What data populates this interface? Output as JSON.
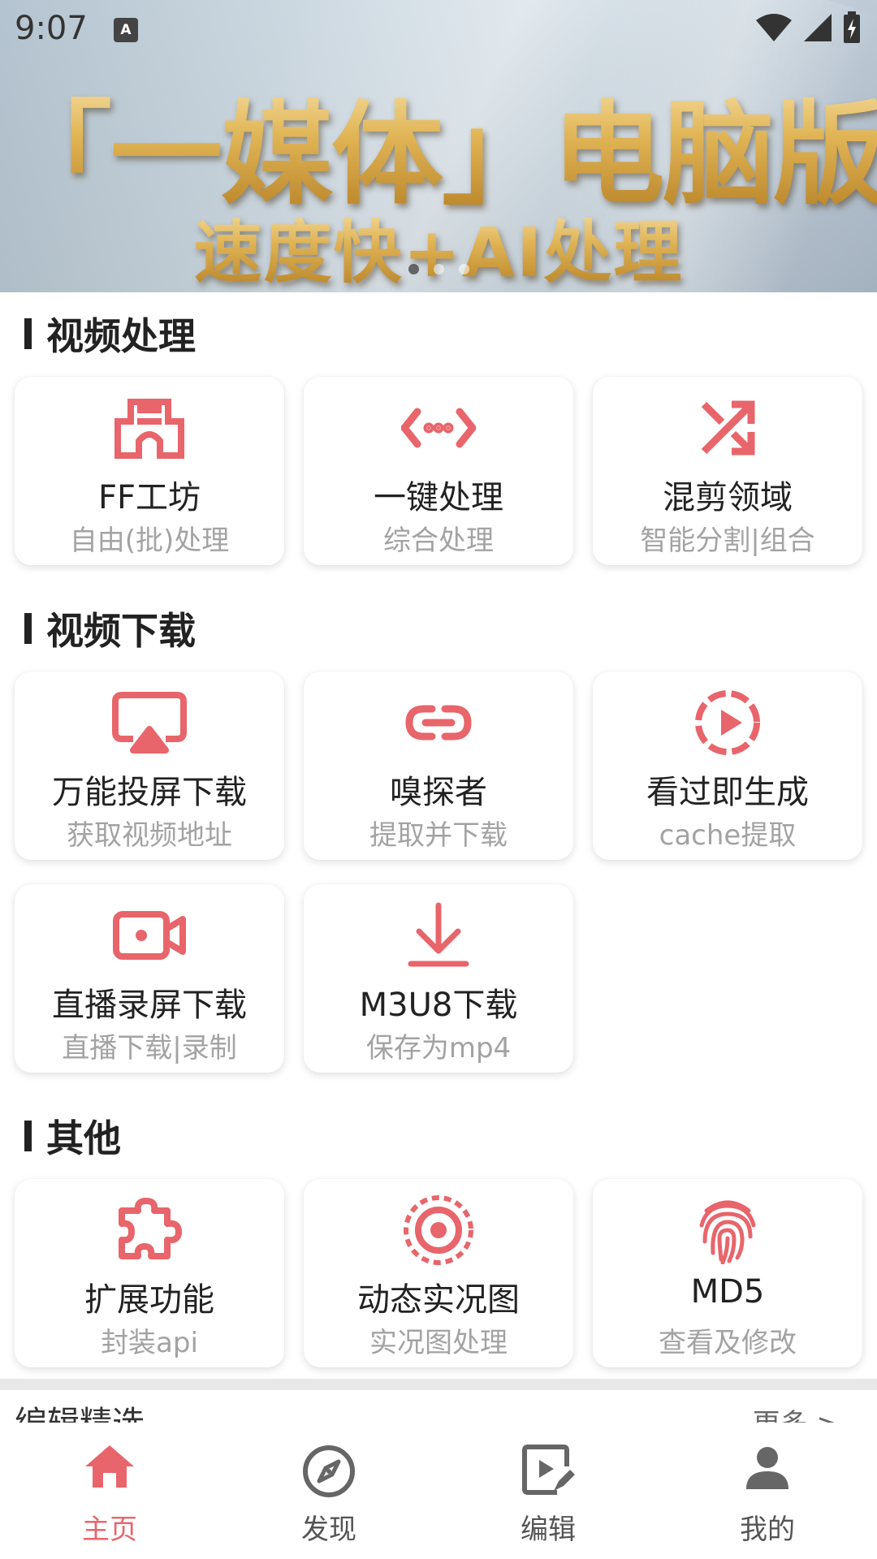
{
  "status_bar": {
    "time": "9:07",
    "notification_icon": "A"
  },
  "banner": {
    "title_line1": "「一媒体」电脑版",
    "title_line2": "速度快+AI处理",
    "slide_count": 3,
    "active_slide": 1
  },
  "accent_color": "#e8656b",
  "sections": {
    "video_processing": {
      "title": "视频处理",
      "items": [
        {
          "title": "FF工坊",
          "subtitle": "自由(批)处理",
          "icon": "castle-icon"
        },
        {
          "title": "一键处理",
          "subtitle": "综合处理",
          "icon": "code-arrows-icon"
        },
        {
          "title": "混剪领域",
          "subtitle": "智能分割|组合",
          "icon": "shuffle-icon"
        }
      ]
    },
    "video_download": {
      "title": "视频下载",
      "items": [
        {
          "title": "万能投屏下载",
          "subtitle": "获取视频地址",
          "icon": "airplay-icon"
        },
        {
          "title": "嗅探者",
          "subtitle": "提取并下载",
          "icon": "link-icon"
        },
        {
          "title": "看过即生成",
          "subtitle": "cache提取",
          "icon": "play-circle-icon"
        },
        {
          "title": "直播录屏下载",
          "subtitle": "直播下载|录制",
          "icon": "video-camera-icon"
        },
        {
          "title": "M3U8下载",
          "subtitle": "保存为mp4",
          "icon": "download-icon"
        }
      ]
    },
    "other": {
      "title": "其他",
      "items": [
        {
          "title": "扩展功能",
          "subtitle": "封装api",
          "icon": "puzzle-icon"
        },
        {
          "title": "动态实况图",
          "subtitle": "实况图处理",
          "icon": "live-photo-icon"
        },
        {
          "title": "MD5",
          "subtitle": "查看及修改",
          "icon": "fingerprint-icon"
        }
      ]
    }
  },
  "peek_section": {
    "title": "编辑精选",
    "more_label": "更多 >"
  },
  "bottom_nav": [
    {
      "label": "主页",
      "icon": "home-icon",
      "active": true
    },
    {
      "label": "发现",
      "icon": "compass-icon",
      "active": false
    },
    {
      "label": "编辑",
      "icon": "edit-icon",
      "active": false
    },
    {
      "label": "我的",
      "icon": "person-icon",
      "active": false
    }
  ]
}
